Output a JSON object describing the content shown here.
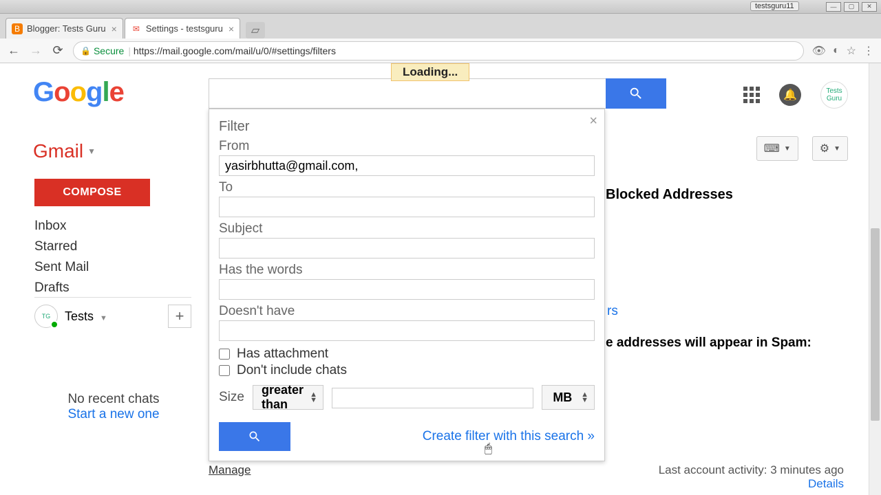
{
  "window": {
    "user": "testsguru11"
  },
  "tabs": [
    {
      "label": "Blogger: Tests Guru",
      "favicon": "B"
    },
    {
      "label": "Settings - testsguru",
      "favicon": "M"
    }
  ],
  "url": {
    "secure_label": "Secure",
    "text": "https://mail.google.com/mail/u/0/#settings/filters"
  },
  "loading": "Loading...",
  "brand": {
    "name": "Gmail"
  },
  "compose": "COMPOSE",
  "nav": {
    "inbox": "Inbox",
    "starred": "Starred",
    "sent": "Sent Mail",
    "drafts": "Drafts"
  },
  "hangouts": {
    "name": "Tests",
    "empty1": "No recent chats",
    "empty2": "Start a new one"
  },
  "toolbar": {
    "keyboard": "⌨"
  },
  "peek": {
    "blocked": "Blocked Addresses",
    "filters_link": "rs",
    "spam_line": "e addresses will appear in Spam:"
  },
  "filter": {
    "title": "Filter",
    "from_label": "From",
    "from_value": "yasirbhutta@gmail.com,",
    "to_label": "To",
    "to_value": "",
    "subject_label": "Subject",
    "subject_value": "",
    "haswords_label": "Has the words",
    "haswords_value": "",
    "doesnthave_label": "Doesn't have",
    "doesnthave_value": "",
    "has_attachment": "Has attachment",
    "dont_include_chats": "Don't include chats",
    "size_label": "Size",
    "size_op": "greater than",
    "size_value": "",
    "size_unit": "MB",
    "create_link": "Create filter with this search »"
  },
  "footer": {
    "activity": "Last account activity: 3 minutes ago",
    "details": "Details",
    "manage": "Manage"
  },
  "profile": {
    "label": "Tests Guru"
  }
}
